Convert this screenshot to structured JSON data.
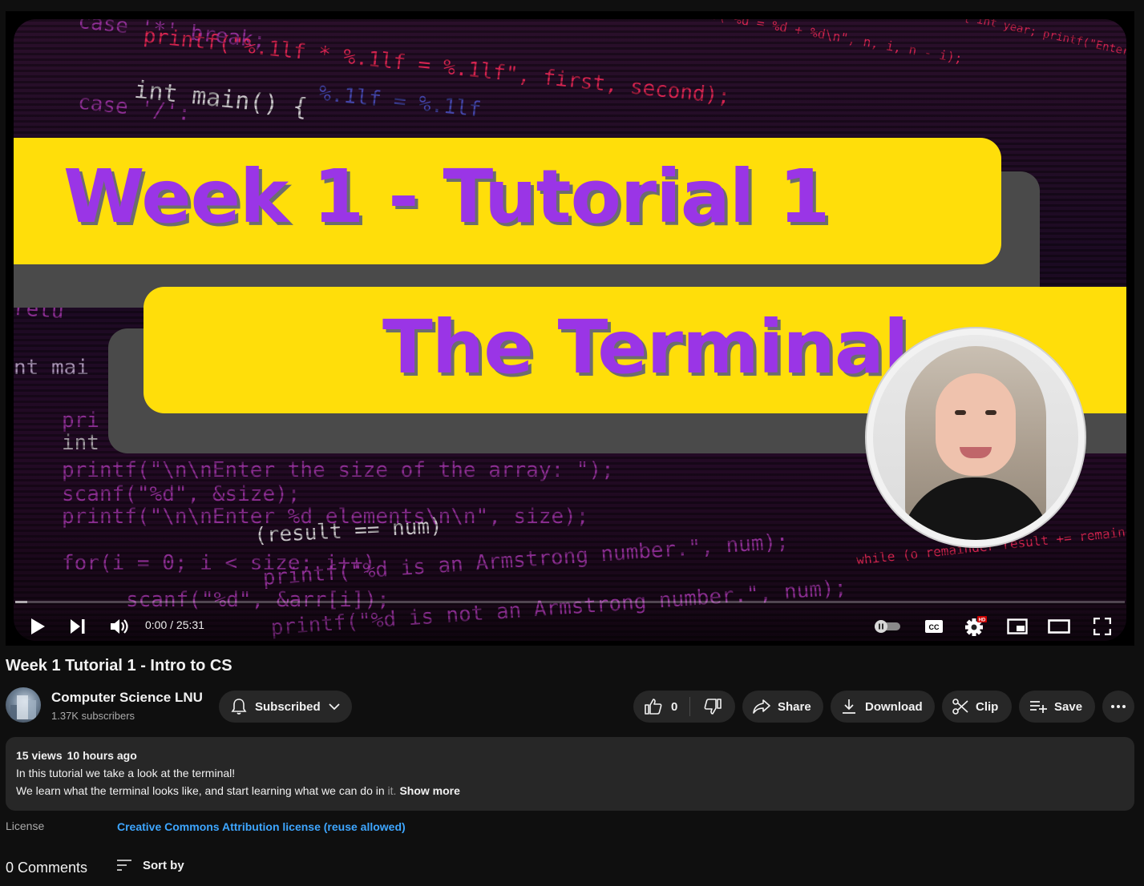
{
  "player": {
    "thumbnail": {
      "line1": "Week 1 - Tutorial 1",
      "line2": "The Terminal"
    },
    "time_display": "0:00 / 25:31",
    "progress_fraction": 0.011,
    "hd_badge": "HD",
    "cc_label": "CC"
  },
  "video": {
    "title": "Week 1 Tutorial 1 - Intro to CS"
  },
  "channel": {
    "name": "Computer Science LNU",
    "subscribers": "1.37K subscribers",
    "subscribe_label": "Subscribed"
  },
  "actions": {
    "like_count": "0",
    "share_label": "Share",
    "download_label": "Download",
    "clip_label": "Clip",
    "save_label": "Save"
  },
  "description": {
    "views": "15 views",
    "age": "10 hours ago",
    "line1": "In this tutorial we take a look at the terminal!",
    "line2_main": "We learn what the terminal looks like, and start learning what we can do in ",
    "line2_faded": "it.",
    "show_more": "Show more"
  },
  "license": {
    "label": "License",
    "value": "Creative Commons Attribution license (reuse allowed)"
  },
  "comments": {
    "count_label": "0 Comments",
    "sort_label": "Sort by"
  },
  "colors": {
    "accent_link": "#3ea6ff",
    "banner_yellow": "#ffde0a",
    "banner_text_purple": "#9a35e6",
    "hd_red": "#cc0000"
  }
}
